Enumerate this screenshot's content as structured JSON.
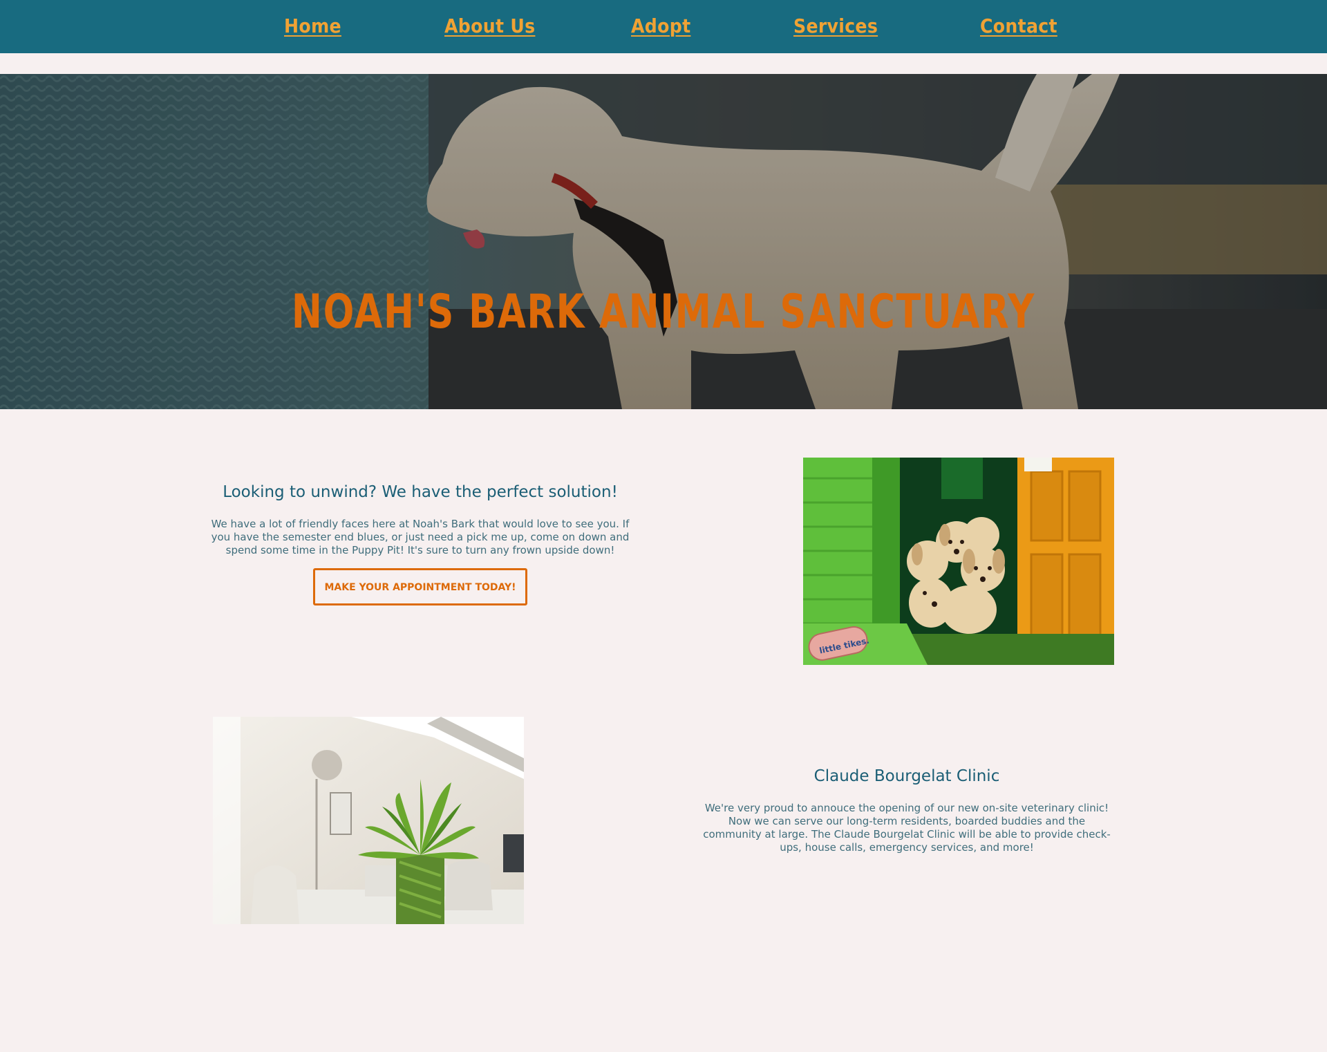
{
  "nav": {
    "items": [
      {
        "label": "Home"
      },
      {
        "label": "About Us"
      },
      {
        "label": "Adopt"
      },
      {
        "label": "Services"
      },
      {
        "label": "Contact"
      }
    ]
  },
  "hero": {
    "title": "NOAH'S BARK ANIMAL SANCTUARY",
    "image": "dog-by-fence-photo"
  },
  "section_unwind": {
    "heading": "Looking to unwind? We have the perfect solution!",
    "body": "We have a lot of friendly faces here at Noah's Bark that would love to see you. If you have the semester end blues, or just need a pick me up, come on down and spend some time in the Puppy Pit! It's sure to turn any frown upside down!",
    "cta_label": "MAKE YOUR APPOINTMENT TODAY!",
    "image": "puppies-in-playhouse-photo",
    "image_logo_text": "little tikes."
  },
  "section_clinic": {
    "heading": "Claude Bourgelat Clinic",
    "body": "We're very proud to annouce the opening of our new on-site veterinary clinic! Now we can serve our long-term residents, boarded buddies and the community at large. The Claude Bourgelat Clinic will be able to provide check-ups, house calls, emergency services, and more!",
    "image": "clinic-interior-photo"
  },
  "colors": {
    "nav_bg": "#186b80",
    "nav_link": "#f0a234",
    "accent_orange": "#dd6a09",
    "heading_teal": "#1b5e75",
    "page_bg": "#f7f0f0"
  }
}
